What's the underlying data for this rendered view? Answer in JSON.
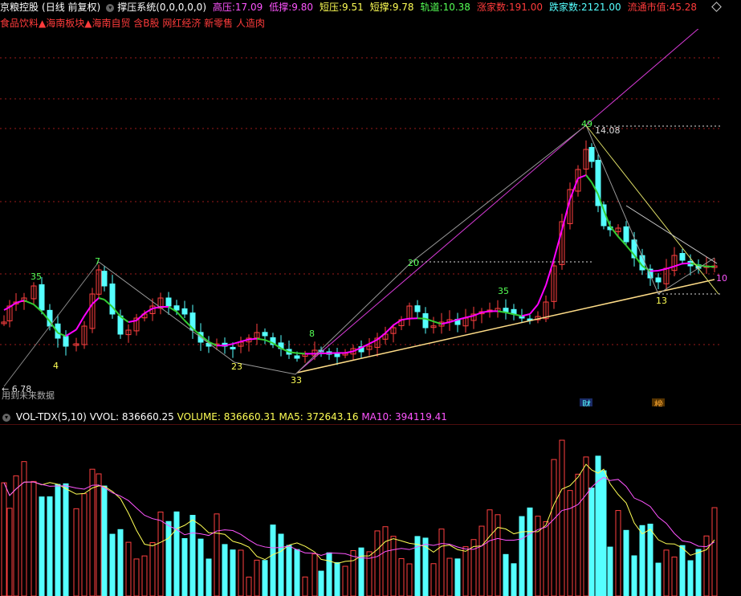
{
  "header": {
    "stock_title": "京粮控股",
    "period": "(日线 前复权)",
    "indicator_name": "撑压系统(0,0,0,0,0)",
    "metrics": [
      {
        "label": "高压:",
        "value": "17.09",
        "color": "#ff55ff"
      },
      {
        "label": "低撑:",
        "value": "9.80",
        "color": "#ff55ff"
      },
      {
        "label": "短压:",
        "value": "9.51",
        "color": "#ffff55"
      },
      {
        "label": "短撑:",
        "value": "9.78",
        "color": "#ffff55"
      },
      {
        "label": "轨道:",
        "value": "10.38",
        "color": "#55ff55"
      },
      {
        "label": "涨家数:",
        "value": "191.00",
        "color": "#ff3b3b"
      },
      {
        "label": "跌家数:",
        "value": "2121.00",
        "color": "#55ffff"
      },
      {
        "label": "流通市值:",
        "value": "45.28",
        "color": "#ff3b3b"
      }
    ]
  },
  "tags": "食品饮料▲海南板块▲海南自贸 含B股 网红经济 新零售 人造肉",
  "price_chart": {
    "annotations": {
      "low_price": "6.78",
      "no_future": "用到未来数据",
      "peak_value": "14.08",
      "peak_label": "49",
      "label_35a": "35",
      "label_7": "7",
      "label_4": "4",
      "label_8": "8",
      "label_23": "23",
      "label_33": "33",
      "label_20": "20",
      "label_35b": "35",
      "label_13": "13",
      "label_10": "10",
      "marker_1": "财",
      "marker_2": "榜"
    },
    "up_color": "#ff4040",
    "down_color": "#55ffff",
    "ma_up_color": "#ff00ff",
    "ma_down_color": "#33cc33"
  },
  "volume": {
    "indicator": "VOL-TDX(5,10)",
    "vvol_label": "VVOL:",
    "vvol_value": "836660.25",
    "volume_label": "VOLUME:",
    "volume_value": "836660.31",
    "ma5_label": "MA5:",
    "ma5_value": "372643.16",
    "ma10_label": "MA10:",
    "ma10_value": "394119.41"
  }
}
